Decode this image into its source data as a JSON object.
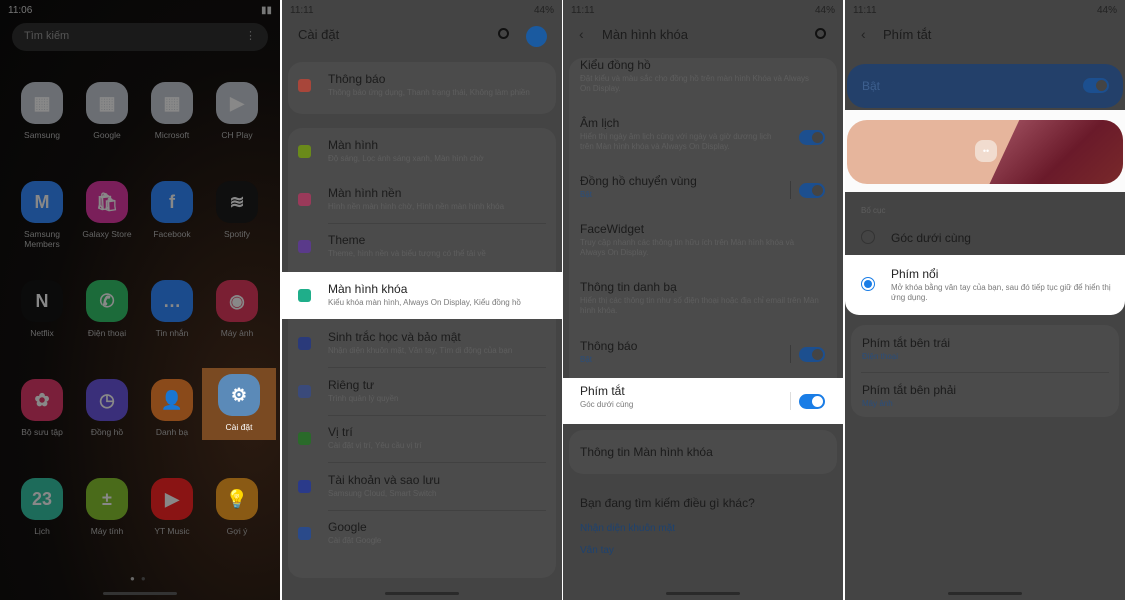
{
  "home": {
    "time": "11:06",
    "search_placeholder": "Tìm kiếm",
    "menu_icon": "more-vert-icon",
    "apps": [
      {
        "label": "Samsung",
        "color": "#6b6e73",
        "glyph": "▦"
      },
      {
        "label": "Google",
        "color": "#6b6e73",
        "glyph": "▦"
      },
      {
        "label": "Microsoft",
        "color": "#6b6e73",
        "glyph": "▦"
      },
      {
        "label": "CH Play",
        "color": "#6b6e73",
        "glyph": "▶"
      },
      {
        "label": "Samsung Members",
        "color": "#1d4c8c",
        "glyph": "M"
      },
      {
        "label": "Galaxy Store",
        "color": "#7a1f5a",
        "glyph": "🛍"
      },
      {
        "label": "Facebook",
        "color": "#1b4b8c",
        "glyph": "f"
      },
      {
        "label": "Spotify",
        "color": "#0f0f0f",
        "glyph": "≋"
      },
      {
        "label": "Netflix",
        "color": "#0b0b0b",
        "glyph": "N"
      },
      {
        "label": "Điện thoại",
        "color": "#1c6b3a",
        "glyph": "✆"
      },
      {
        "label": "Tin nhắn",
        "color": "#1b4b8c",
        "glyph": "…"
      },
      {
        "label": "Máy ảnh",
        "color": "#7a1f33",
        "glyph": "◉"
      },
      {
        "label": "Bộ sưu tập",
        "color": "#7a1f3a",
        "glyph": "✿"
      },
      {
        "label": "Đồng hồ",
        "color": "#3a2f7a",
        "glyph": "◷"
      },
      {
        "label": "Danh bạ",
        "color": "#8a4a1a",
        "glyph": "👤"
      },
      {
        "label": "Cài đặt",
        "color": "#5b8ab8",
        "glyph": "⚙",
        "selected": true
      },
      {
        "label": "Lịch",
        "color": "#1d6b5a",
        "glyph": "23"
      },
      {
        "label": "Máy tính",
        "color": "#4a6b1a",
        "glyph": "±"
      },
      {
        "label": "YT Music",
        "color": "#8a1414",
        "glyph": "▶"
      },
      {
        "label": "Gợi ý",
        "color": "#8a5a14",
        "glyph": "💡"
      }
    ]
  },
  "settings": {
    "time": "11:11",
    "battery": "44%",
    "title": "Cài đặt",
    "search_icon": "search-icon",
    "profile_icon": "account-icon",
    "items": [
      {
        "title": "Thông báo",
        "sub": "Thông báo ứng dụng, Thanh trạng thái, Không làm phiền",
        "icon_color": "#a8463a"
      },
      {
        "title": "Màn hình",
        "sub": "Độ sáng, Lọc ánh sáng xanh, Màn hình chờ",
        "icon_color": "#6a8a1a"
      },
      {
        "title": "Màn hình nền",
        "sub": "Hình nền màn hình chờ, Hình nền màn hình khóa",
        "icon_color": "#9a3a5a"
      },
      {
        "title": "Theme",
        "sub": "Theme, hình nền và biểu tượng có thể tải về",
        "icon_color": "#5a3a8a"
      },
      {
        "title": "Màn hình khóa",
        "sub": "Kiểu khóa màn hình, Always On Display, Kiểu đồng hồ",
        "icon_color": "#1fae8a",
        "highlighted": true
      },
      {
        "title": "Sinh trắc học và bảo mật",
        "sub": "Nhận diện khuôn mặt, Vân tay, Tìm di động của bạn",
        "icon_color": "#2a3a7a"
      },
      {
        "title": "Riêng tư",
        "sub": "Trình quản lý quyền",
        "icon_color": "#3a4a7a"
      },
      {
        "title": "Vị trí",
        "sub": "Cài đặt vị trí, Yêu cầu vị trí",
        "icon_color": "#2a6a2a"
      },
      {
        "title": "Tài khoản và sao lưu",
        "sub": "Samsung Cloud, Smart Switch",
        "icon_color": "#2a3a8a"
      },
      {
        "title": "Google",
        "sub": "Cài đặt Google",
        "icon_color": "#2a4a8a"
      }
    ]
  },
  "lockscreen": {
    "time": "11:11",
    "battery": "44%",
    "title": "Màn hình khóa",
    "items": [
      {
        "title": "Kiểu đồng hồ",
        "sub": "Đặt kiểu và màu sắc cho đồng hồ trên màn hình Khóa và Always On Display."
      },
      {
        "title": "Âm lịch",
        "sub": "Hiển thị ngày âm lịch cùng với ngày và giờ dương lịch trên Màn hình khóa và Always On Display.",
        "toggle": true
      },
      {
        "title": "Đồng hồ chuyển vùng",
        "sub": "Bật",
        "sub_blue": true,
        "toggle": true,
        "separator": true
      },
      {
        "title": "FaceWidget",
        "sub": "Truy cập nhanh các thông tin hữu ích trên Màn hình khóa và Always On Display."
      },
      {
        "title": "Thông tin danh bạ",
        "sub": "Hiển thị các thông tin như số điện thoại hoặc địa chỉ email trên Màn hình khóa."
      },
      {
        "title": "Thông báo",
        "sub": "Bật",
        "sub_blue": true,
        "toggle": true,
        "separator": true
      },
      {
        "title": "Phím tắt",
        "sub": "Góc dưới cùng",
        "toggle": true,
        "separator": true,
        "highlighted": true
      }
    ],
    "about": "Thông tin Màn hình khóa",
    "suggest_title": "Bạn đang tìm kiếm điều gì khác?",
    "suggest_links": [
      "Nhận diện khuôn mặt",
      "Vân tay"
    ]
  },
  "shortcuts": {
    "time": "11:11",
    "battery": "44%",
    "title": "Phím tắt",
    "master_label": "Bật",
    "master_on": true,
    "layout_label": "Bố cục",
    "options": [
      {
        "title": "Góc dưới cùng",
        "selected": false
      },
      {
        "title": "Phím nổi",
        "sub": "Mở khóa bằng vân tay của bạn, sau đó tiếp tục giữ để hiển thị ứng dụng.",
        "selected": true
      }
    ],
    "left": {
      "title": "Phím tắt bên trái",
      "value": "Điện thoại"
    },
    "right": {
      "title": "Phím tắt bên phải",
      "value": "Máy ảnh"
    },
    "accent": "#1a7de6"
  }
}
